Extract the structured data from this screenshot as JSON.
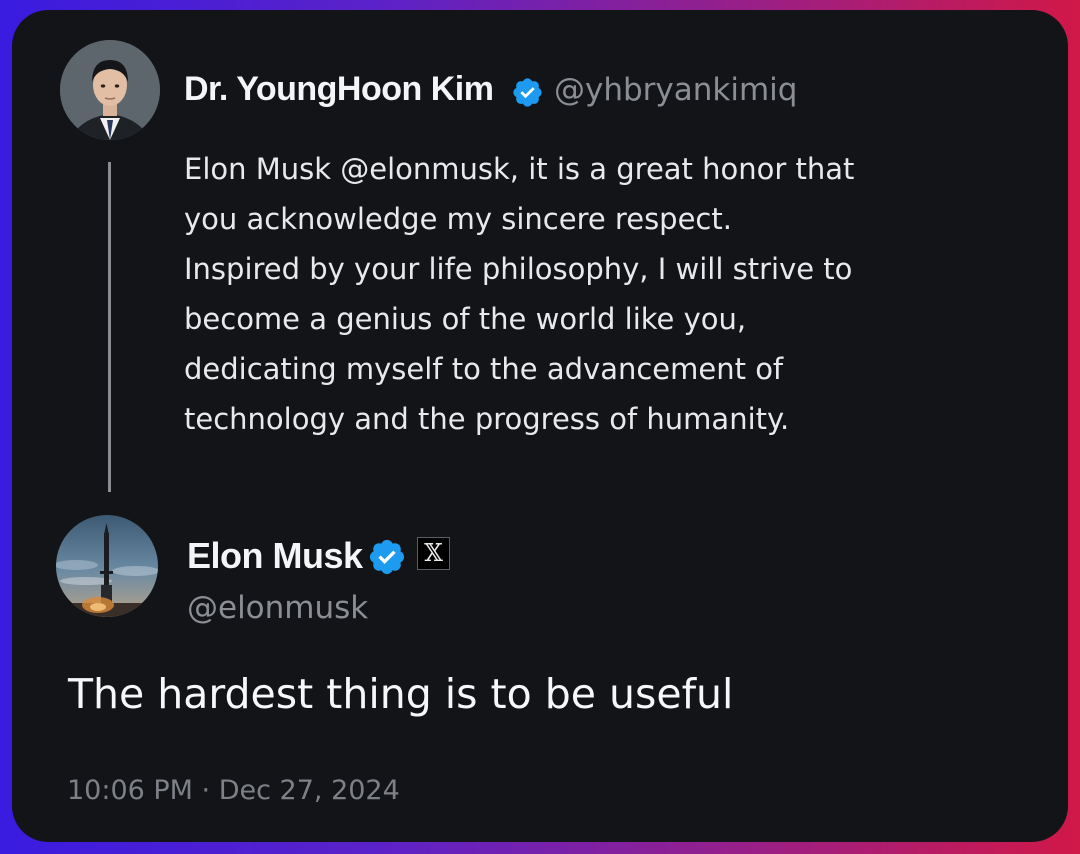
{
  "quoted_post": {
    "author_name": "Dr. YoungHoon Kim",
    "author_handle": "@yhbryankimiq",
    "verified_icon": "verified-badge-icon",
    "text_lines": [
      "Elon Musk @elonmusk, it is a great honor that",
      "you acknowledge my sincere respect.",
      "Inspired by your life philosophy, I will strive to",
      "become a genius of the world like you,",
      "dedicating myself to the advancement of",
      "technology and the progress of humanity."
    ]
  },
  "reply_post": {
    "author_name": "Elon Musk",
    "author_handle": "@elonmusk",
    "verified_icon": "verified-badge-icon",
    "affiliate_badge_glyph": "𝕏",
    "text": "The hardest thing is to be useful",
    "timestamp": "10:06 PM · Dec 27, 2024"
  },
  "colors": {
    "card_background": "#131417",
    "verified_blue": "#1d9bf0",
    "secondary_text": "#8b8f95",
    "primary_text": "#f4f5f6"
  }
}
